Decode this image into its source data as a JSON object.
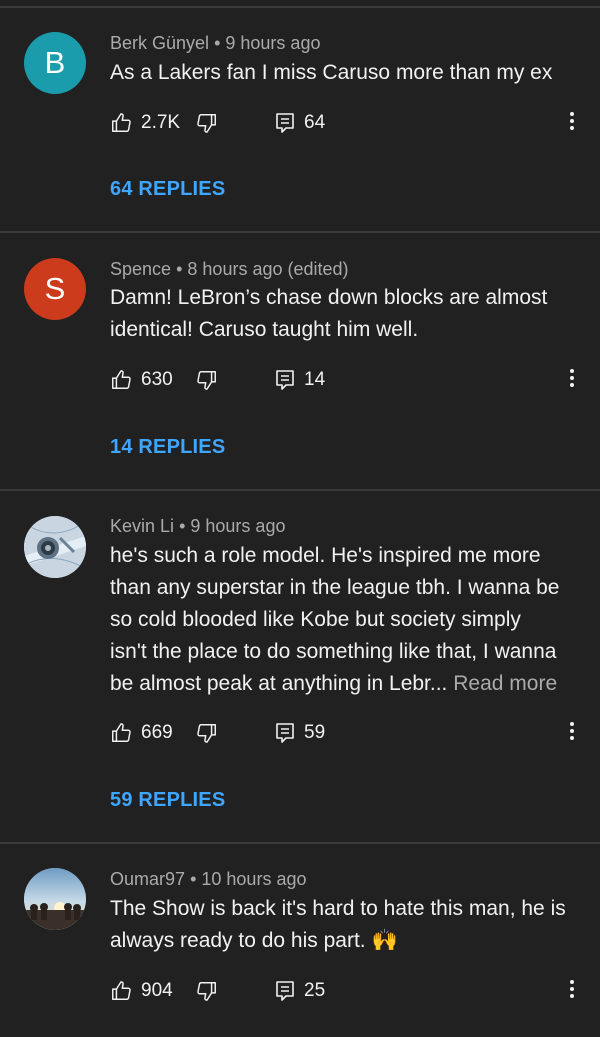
{
  "comments": [
    {
      "initial": "B",
      "avatar_color": "#1a9cad",
      "author": "Berk Günyel",
      "time": "9 hours ago",
      "edited": "",
      "lines": [
        "As a Lakers fan I miss Caruso more than my ex"
      ],
      "read_more": "",
      "likes": "2.7K",
      "reply_count": "64",
      "replies_label": "64 REPLIES"
    },
    {
      "initial": "S",
      "avatar_color": "#cc3b1b",
      "author": "Spence",
      "time": "8 hours ago",
      "edited": "(edited)",
      "lines": [
        "Damn! LeBron’s chase down blocks are almost",
        "identical! Caruso taught him well."
      ],
      "read_more": "",
      "likes": "630",
      "reply_count": "14",
      "replies_label": "14 REPLIES"
    },
    {
      "initial": "",
      "avatar_color": "#b9c9d6",
      "author": "Kevin Li",
      "time": "9 hours ago",
      "edited": "",
      "lines": [
        "he's such a role model. He's inspired me more",
        "than any superstar in the league tbh. I wanna be",
        "so cold blooded like Kobe but society simply",
        "isn't the place to do something like that, I wanna",
        "be almost peak at anything in Lebr..."
      ],
      "read_more": "Read more",
      "likes": "669",
      "reply_count": "59",
      "replies_label": "59 REPLIES"
    },
    {
      "initial": "",
      "avatar_color": "#7ea6c8",
      "author": "Oumar97",
      "time": "10 hours ago",
      "edited": "",
      "lines": [
        "The Show is back it's hard to hate this man, he is",
        "always ready to do his part."
      ],
      "emoji": "🙌",
      "read_more": "",
      "likes": "904",
      "reply_count": "25",
      "replies_label": ""
    }
  ],
  "separator": "•",
  "icons": {
    "like": "thumbs-up-icon",
    "dislike": "thumbs-down-icon",
    "reply": "reply-comment-icon",
    "more": "more-vertical-icon"
  },
  "colors": {
    "background": "#212121",
    "link": "#3ea6ff",
    "secondary": "#aaaaaa"
  }
}
